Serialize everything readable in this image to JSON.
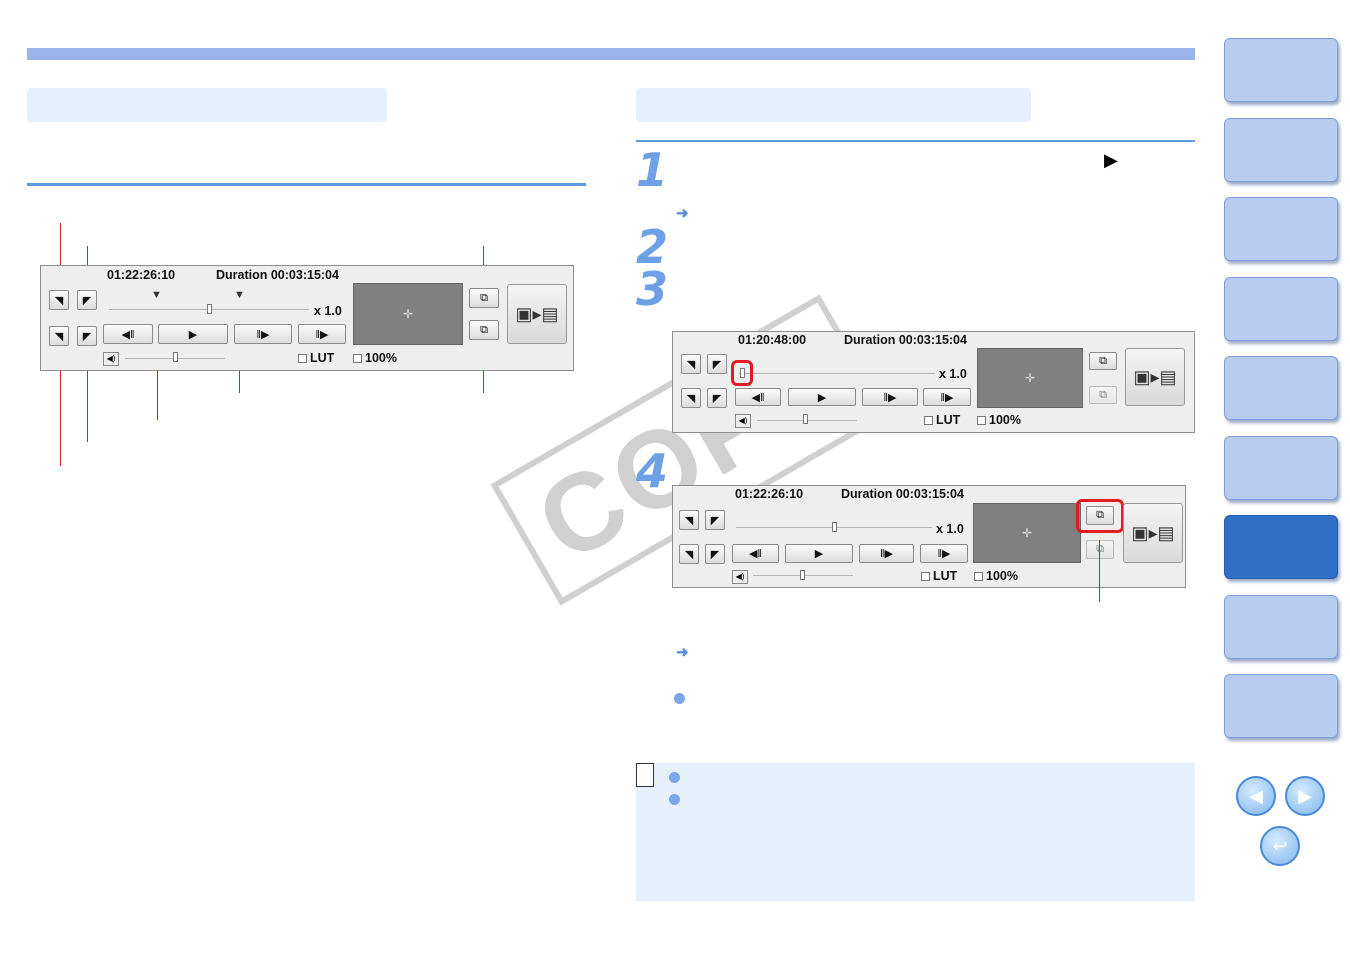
{
  "player_main": {
    "timecode": "01:22:26:10",
    "duration": "Duration 00:03:15:04",
    "speed": "x 1.0",
    "lut_label": "LUT",
    "zoom_label": "100%"
  },
  "player_step3": {
    "timecode": "01:20:48:00",
    "duration": "Duration 00:03:15:04",
    "speed": "x 1.0",
    "lut_label": "LUT",
    "zoom_label": "100%"
  },
  "player_step4": {
    "timecode": "01:22:26:10",
    "duration": "Duration 00:03:15:04",
    "speed": "x 1.0",
    "lut_label": "LUT",
    "zoom_label": "100%"
  },
  "steps": [
    "1",
    "2",
    "3",
    "4"
  ],
  "watermark": "COPY",
  "icons": {
    "arrow_bullet": "➜",
    "play": "▶",
    "nav_prev": "◀",
    "nav_next": "▶",
    "nav_home": "↩"
  },
  "colors": {
    "accent_blue": "#5c9be0",
    "callout_red": "#d21f2a",
    "tab_active": "#2f6fc6",
    "tab_inactive": "#b8ccf0"
  }
}
